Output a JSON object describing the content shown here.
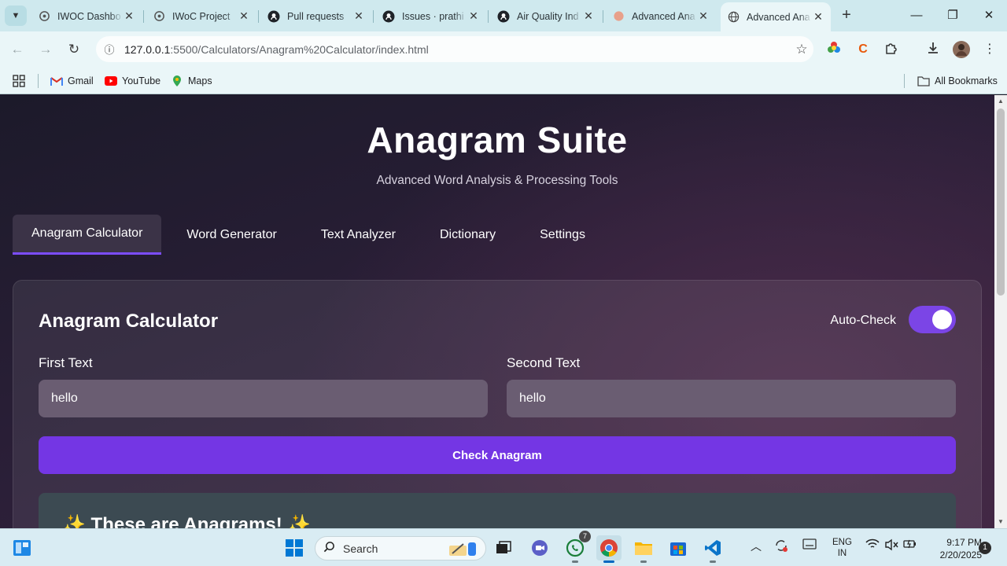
{
  "browser": {
    "tabs": [
      {
        "title": "IWOC Dashbo",
        "icon": "iwoc-logo-icon"
      },
      {
        "title": "IWoC Project",
        "icon": "iwoc-logo-icon"
      },
      {
        "title": "Pull requests",
        "icon": "github-icon"
      },
      {
        "title": "Issues · prathi",
        "icon": "github-icon"
      },
      {
        "title": "Air Quality Ind",
        "icon": "github-icon"
      },
      {
        "title": "Advanced Ana",
        "icon": "page-icon"
      },
      {
        "title": "Advanced Ana",
        "icon": "globe-icon",
        "active": true
      }
    ],
    "url_host": "127.0.0.1",
    "url_path": ":5500/Calculators/Anagram%20Calculator/index.html",
    "bookmarks": [
      {
        "label": "Gmail",
        "icon": "gmail-icon",
        "color": "#d93025"
      },
      {
        "label": "YouTube",
        "icon": "youtube-icon",
        "color": "#ff0000"
      },
      {
        "label": "Maps",
        "icon": "maps-icon",
        "color": "#34a853"
      }
    ],
    "all_bookmarks": "All Bookmarks"
  },
  "page": {
    "title": "Anagram Suite",
    "subtitle": "Advanced Word Analysis & Processing Tools",
    "tabs": [
      "Anagram Calculator",
      "Word Generator",
      "Text Analyzer",
      "Dictionary",
      "Settings"
    ],
    "active_tab": 0,
    "card": {
      "title": "Anagram Calculator",
      "auto_check_label": "Auto-Check",
      "auto_check_on": true,
      "first_label": "First Text",
      "first_value": "hello",
      "second_label": "Second Text",
      "second_value": "hello",
      "button": "Check Anagram",
      "result": "✨ These are Anagrams! ✨"
    },
    "accent_color": "#7436e4"
  },
  "taskbar": {
    "search_placeholder": "Search",
    "whatsapp_badge": "7",
    "lang_line1": "ENG",
    "lang_line2": "IN",
    "time": "9:17 PM",
    "date": "2/20/2025",
    "notifications": "1"
  }
}
